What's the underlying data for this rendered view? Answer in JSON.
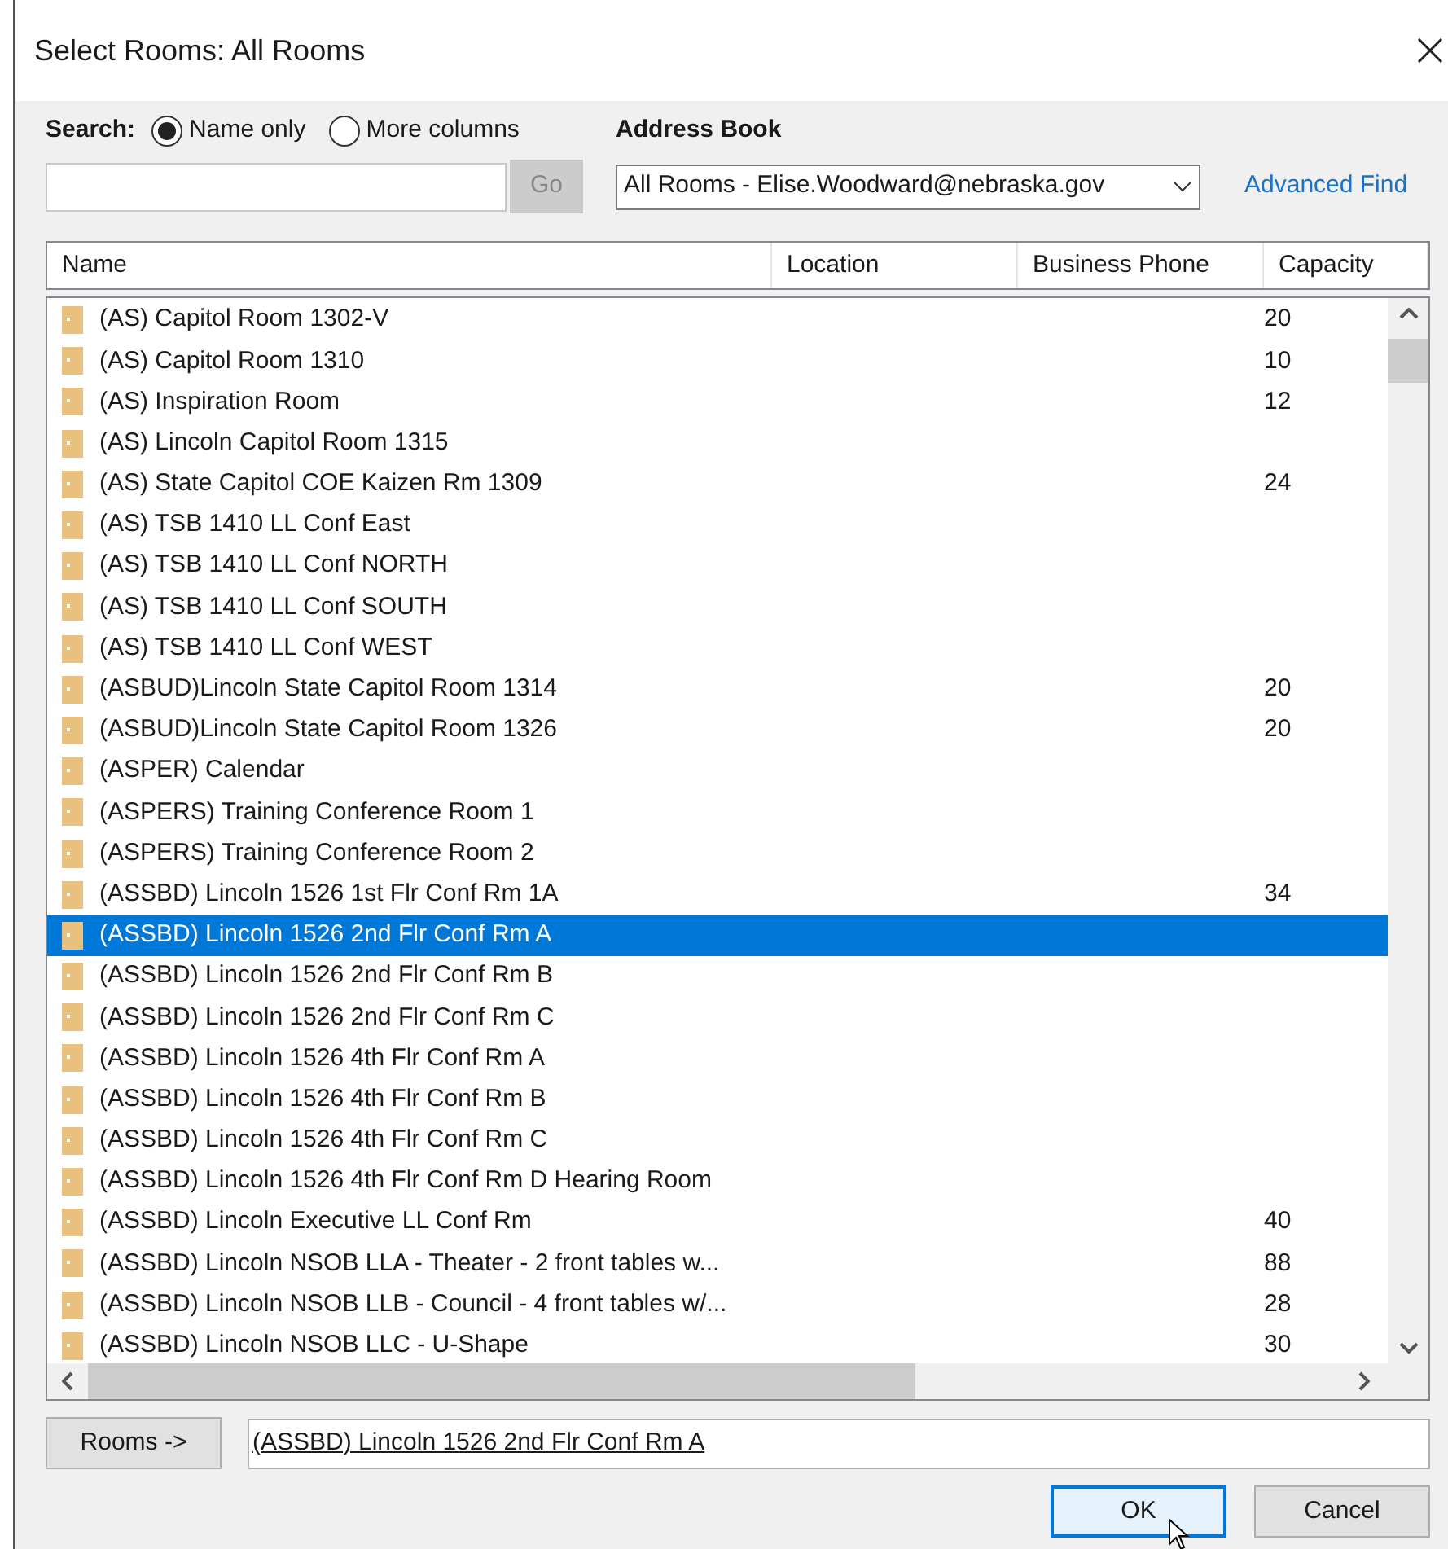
{
  "window": {
    "title": "Select Rooms: All Rooms"
  },
  "search": {
    "label": "Search:",
    "options": [
      {
        "label": "Name only",
        "selected": true
      },
      {
        "label": "More columns",
        "selected": false
      }
    ],
    "go_button": "Go",
    "go_disabled": true
  },
  "address_book": {
    "label": "Address Book",
    "value": "All Rooms - Elise.Woodward@nebraska.gov",
    "advanced_find": "Advanced Find"
  },
  "table": {
    "columns": [
      "Name",
      "Location",
      "Business Phone",
      "Capacity"
    ],
    "rows": [
      {
        "name": "(AS) Capitol Room 1302-V",
        "capacity": "20",
        "selected": false
      },
      {
        "name": "(AS) Capitol Room 1310",
        "capacity": "10",
        "selected": false
      },
      {
        "name": "(AS) Inspiration Room",
        "capacity": "12",
        "selected": false
      },
      {
        "name": "(AS) Lincoln Capitol Room 1315",
        "selected": false
      },
      {
        "name": "(AS) State Capitol COE Kaizen Rm 1309",
        "capacity": "24",
        "selected": false
      },
      {
        "name": "(AS) TSB 1410 LL Conf East",
        "selected": false
      },
      {
        "name": "(AS) TSB 1410 LL Conf NORTH",
        "selected": false
      },
      {
        "name": "(AS) TSB 1410 LL Conf SOUTH",
        "selected": false
      },
      {
        "name": "(AS) TSB 1410 LL Conf WEST",
        "selected": false
      },
      {
        "name": "(ASBUD)Lincoln State Capitol Room 1314",
        "capacity": "20",
        "selected": false
      },
      {
        "name": "(ASBUD)Lincoln State Capitol Room 1326",
        "capacity": "20",
        "selected": false
      },
      {
        "name": "(ASPER) Calendar",
        "selected": false
      },
      {
        "name": "(ASPERS) Training Conference Room 1",
        "selected": false
      },
      {
        "name": "(ASPERS) Training Conference Room 2",
        "selected": false
      },
      {
        "name": "(ASSBD) Lincoln 1526 1st Flr Conf Rm 1A",
        "capacity": "34",
        "selected": false
      },
      {
        "name": "(ASSBD) Lincoln 1526 2nd Flr Conf Rm A",
        "selected": true
      },
      {
        "name": "(ASSBD) Lincoln 1526 2nd Flr Conf Rm B",
        "selected": false
      },
      {
        "name": "(ASSBD) Lincoln 1526 2nd Flr Conf Rm C",
        "selected": false
      },
      {
        "name": "(ASSBD) Lincoln 1526 4th Flr Conf Rm A",
        "selected": false
      },
      {
        "name": "(ASSBD) Lincoln 1526 4th Flr Conf Rm B",
        "selected": false
      },
      {
        "name": "(ASSBD) Lincoln 1526 4th Flr Conf Rm C",
        "selected": false
      },
      {
        "name": "(ASSBD) Lincoln 1526 4th Flr Conf Rm D Hearing Room",
        "selected": false
      },
      {
        "name": "(ASSBD) Lincoln Executive LL Conf Rm",
        "capacity": "40",
        "selected": false
      },
      {
        "name": "(ASSBD) Lincoln NSOB LLA - Theater - 2 front tables w...",
        "capacity": "88",
        "selected": false
      },
      {
        "name": "(ASSBD) Lincoln NSOB LLB - Council - 4 front tables w/...",
        "capacity": "28",
        "selected": false
      },
      {
        "name": "(ASSBD) Lincoln NSOB LLC - U-Shape",
        "capacity": "30",
        "selected": false
      }
    ]
  },
  "rooms_button": "Rooms ->",
  "rooms_value": "(ASSBD) Lincoln 1526 2nd Flr Conf Rm A",
  "buttons": [
    {
      "label": "OK",
      "kind": "default"
    },
    {
      "label": "Cancel",
      "kind": "normal"
    }
  ]
}
